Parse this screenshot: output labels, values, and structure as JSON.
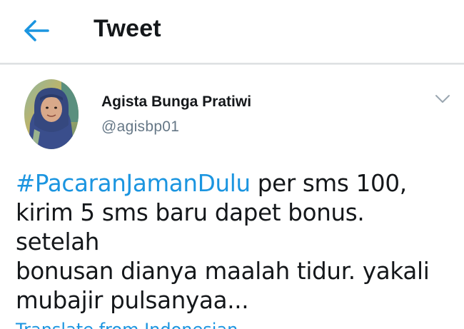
{
  "header": {
    "title": "Tweet",
    "back_icon": "arrow-left-icon",
    "accent": "#1b95e0"
  },
  "tweet": {
    "author_name": "Agista Bunga Pratiwi",
    "author_handle": "@agisbp01",
    "hashtag": "#PacaranJamanDulu",
    "text_lines": [
      " per sms 100,",
      "kirim 5 sms baru dapet bonus. setelah",
      "bonusan dianya maalah tidur. yakali",
      "mubajir pulsanyaa..."
    ],
    "menu_icon": "chevron-down-icon",
    "translate_label": "Translate from Indonesian"
  }
}
